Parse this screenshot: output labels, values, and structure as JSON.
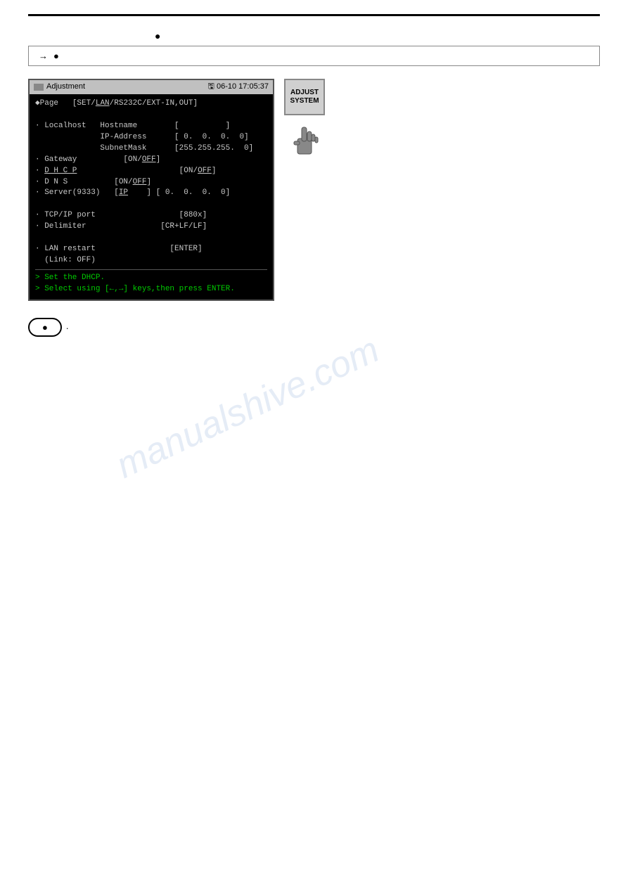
{
  "page": {
    "divider": true,
    "intro": {
      "bullet_text": "●"
    },
    "nav_bar": {
      "text": "→",
      "bullet": "●"
    },
    "terminal": {
      "title": "Adjustment",
      "datetime": "06-10 17:05:37",
      "disk_icon": "🖫",
      "lines": [
        "◆Page   [SET/LAN/RS232C/EXT-IN,OUT]",
        "",
        "· Localhost   Hostname        [          ]",
        "              IP-Address      [ 0.  0.  0.  0]",
        "              SubnetMask      [255.255.255.  0]",
        "· Gateway          [ON/OFF]",
        "· D H C P                         [ON/OFF]",
        "· D N S          [ON/OFF]",
        "· Server(9333)   [IP    ] [ 0.  0.  0.  0]",
        "",
        "· TCP/IP port                   [880x]",
        "· Delimiter                 [CR+LF/LF]",
        "",
        "· LAN restart                   [ENTER]",
        "  (Link: OFF)"
      ],
      "divider_line": "─────────────────────────────────────────",
      "prompt_lines": [
        "> Set the DHCP.",
        "> Select using [←,→] keys,then press ENTER."
      ]
    },
    "adjust_system_btn": {
      "line1": "ADJUST",
      "line2": "SYSTEM"
    },
    "oval_btn_label": "●",
    "watermark_text": "manualshive.com"
  }
}
